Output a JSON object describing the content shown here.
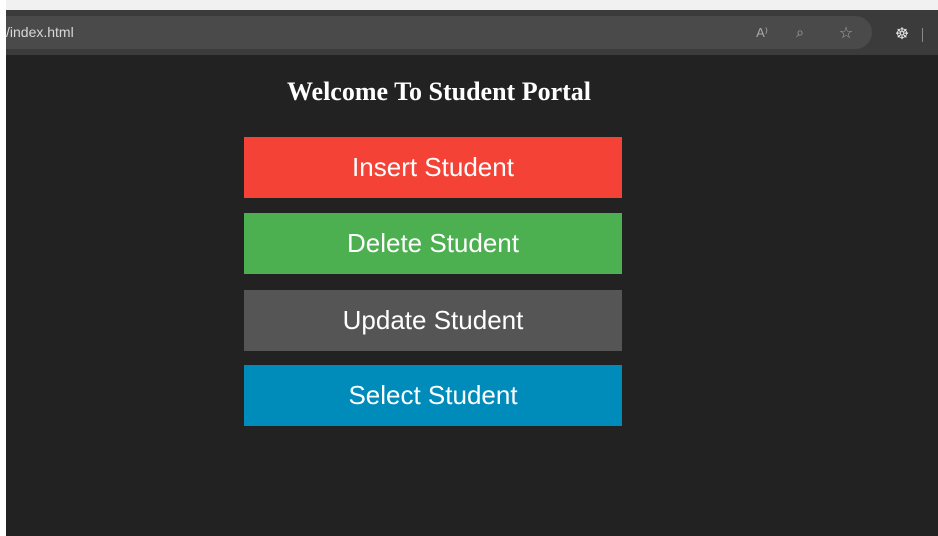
{
  "browser": {
    "url": "/index.html",
    "icons": {
      "read_aloud": "A⁾",
      "zoom": "⌕",
      "favorite": "☆",
      "extensions": "☸"
    }
  },
  "page": {
    "title": "Welcome To Student Portal",
    "buttons": [
      {
        "label": "Insert Student",
        "color": "#f44336"
      },
      {
        "label": "Delete Student",
        "color": "#4caf50"
      },
      {
        "label": "Update Student",
        "color": "#555555"
      },
      {
        "label": "Select Student",
        "color": "#008cba"
      }
    ]
  }
}
